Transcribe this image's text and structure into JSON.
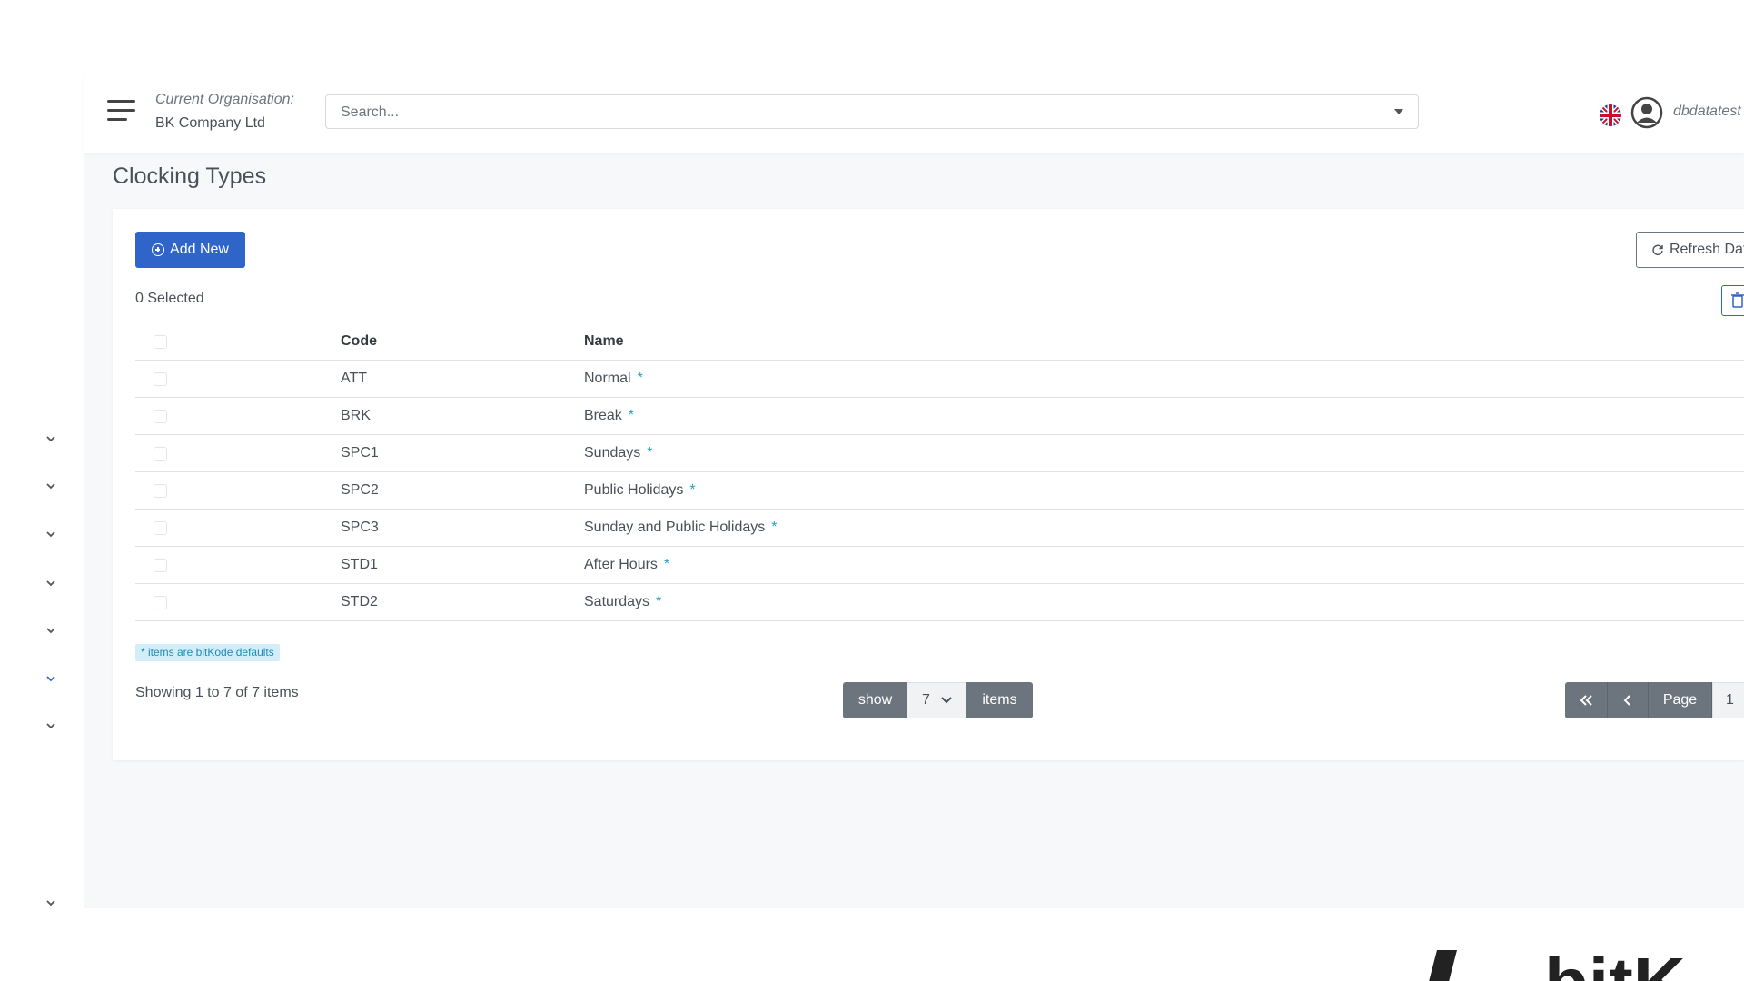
{
  "header": {
    "org_label": "Current Organisation:",
    "org_name": "BK Company Ltd",
    "search_placeholder": "Search...",
    "username": "dbdatatest",
    "language": "en-GB"
  },
  "page": {
    "title": "Clocking Types"
  },
  "toolbar": {
    "add_label": "Add New",
    "refresh_label": "Refresh Data",
    "selected_count": "0 Selected"
  },
  "table": {
    "columns": [
      "Code",
      "Name"
    ],
    "rows": [
      {
        "code": "ATT",
        "name": "Normal",
        "star": "*"
      },
      {
        "code": "BRK",
        "name": "Break",
        "star": "*"
      },
      {
        "code": "SPC1",
        "name": "Sundays",
        "star": "*"
      },
      {
        "code": "SPC2",
        "name": "Public Holidays",
        "star": "*"
      },
      {
        "code": "SPC3",
        "name": "Sunday and Public Holidays",
        "star": "*"
      },
      {
        "code": "STD1",
        "name": "After Hours",
        "star": "*"
      },
      {
        "code": "STD2",
        "name": "Saturdays",
        "star": "*"
      }
    ]
  },
  "footer": {
    "note": "* items are bitKode defaults",
    "showing": "Showing 1 to 7 of 7 items",
    "show_label": "show",
    "page_size": "7",
    "items_label": "items",
    "page_label": "Page",
    "page_number": "1"
  },
  "brand_text": "bitK",
  "colors": {
    "primary": "#2f64c9",
    "pager_gray": "#6c757d",
    "star_blue": "#26a0c9",
    "note_bg": "#d3eef8"
  },
  "sidebar": {
    "icons": [
      "chevron-down-icon",
      "chevron-down-icon",
      "chevron-down-icon",
      "chevron-down-icon",
      "chevron-down-icon",
      "chevron-down-icon",
      "chevron-down-icon",
      "chevron-down-icon"
    ]
  }
}
